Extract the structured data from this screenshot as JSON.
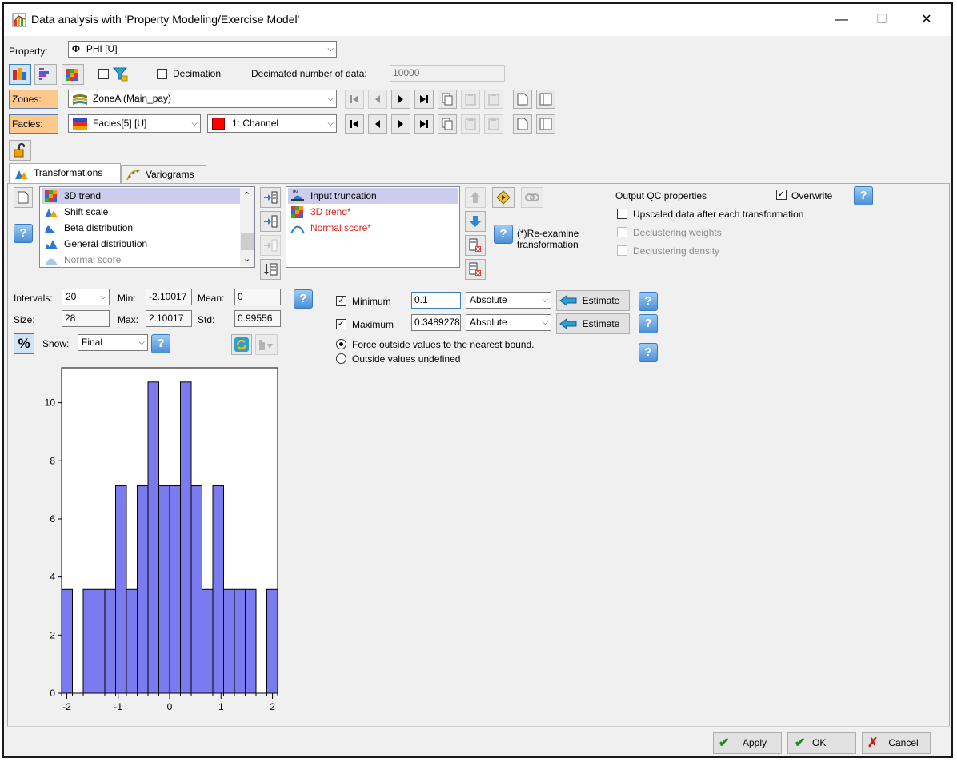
{
  "window": {
    "title": "Data analysis with 'Property Modeling/Exercise Model'",
    "minimize": "—",
    "maximize": "☐",
    "close": "✕"
  },
  "property": {
    "label": "Property:",
    "selected": "PHI [U]",
    "symbol": "Φ"
  },
  "toolbar": {
    "decimation_label": "Decimation",
    "decimated_number_label": "Decimated number of data:",
    "decimated_number_value": "10000"
  },
  "zones": {
    "label": "Zones:",
    "selected": "ZoneA (Main_pay)"
  },
  "facies": {
    "label": "Facies:",
    "selected": "Facies[5] [U]",
    "class_selected": "1: Channel",
    "class_color": "#ff0000"
  },
  "tabs": [
    {
      "label": "Transformations"
    },
    {
      "label": "Variograms"
    }
  ],
  "available_transforms": [
    {
      "label": "3D trend",
      "selected": true
    },
    {
      "label": "Shift scale"
    },
    {
      "label": "Beta distribution"
    },
    {
      "label": "General distribution"
    },
    {
      "label": "Normal score",
      "disabled": true
    }
  ],
  "applied_transforms": [
    {
      "label": "Input truncation",
      "selected": true
    },
    {
      "label": "3D trend*"
    },
    {
      "label": "Normal score*"
    }
  ],
  "reexamine_label": "(*)Re-examine transformation",
  "output_qc": {
    "title": "Output QC properties",
    "overwrite_label": "Overwrite",
    "overwrite_checked": true,
    "upscaled_label": "Upscaled data after each transformation",
    "declustering_weights_label": "Declustering weights",
    "declustering_density_label": "Declustering density"
  },
  "stats": {
    "intervals_label": "Intervals:",
    "intervals_value": "20",
    "min_label": "Min:",
    "min_value": "-2.10017",
    "mean_label": "Mean:",
    "mean_value": "0",
    "size_label": "Size:",
    "size_value": "28",
    "max_label": "Max:",
    "max_value": "2.10017",
    "std_label": "Std:",
    "std_value": "0.99556",
    "percent_label": "%",
    "show_label": "Show:",
    "show_value": "Final"
  },
  "truncation": {
    "minimum_label": "Minimum",
    "minimum_checked": true,
    "minimum_value": "0.1",
    "minimum_mode": "Absolute",
    "maximum_label": "Maximum",
    "maximum_checked": true,
    "maximum_value": "0.3489278",
    "maximum_mode": "Absolute",
    "estimate_label": "Estimate",
    "force_label": "Force outside values to the nearest bound.",
    "undefined_label": "Outside values undefined",
    "force_selected": true
  },
  "footer": {
    "apply_label": "Apply",
    "ok_label": "OK",
    "cancel_label": "Cancel"
  },
  "chart_data": {
    "type": "bar",
    "bar_color": "#7b7bf0",
    "bin_edges": [
      -2.1,
      -1.89,
      -1.68,
      -1.47,
      -1.26,
      -1.05,
      -0.84,
      -0.63,
      -0.42,
      -0.21,
      0.0,
      0.21,
      0.42,
      0.63,
      0.84,
      1.05,
      1.26,
      1.47,
      1.68,
      1.89,
      2.1
    ],
    "values": [
      3.57,
      0,
      3.57,
      3.57,
      3.57,
      7.14,
      3.57,
      7.14,
      10.71,
      7.14,
      7.14,
      10.71,
      7.14,
      3.57,
      7.14,
      3.57,
      3.57,
      3.57,
      0,
      3.57
    ],
    "xlim": [
      -2.1,
      2.1
    ],
    "ylim": [
      0,
      11.2
    ],
    "x_ticks": [
      -2,
      -1,
      0,
      1,
      2
    ],
    "y_ticks": [
      0,
      2,
      4,
      6,
      8,
      10
    ],
    "x_tick_labels": [
      "-2",
      "-1",
      "0",
      "1",
      "2"
    ],
    "y_tick_labels": [
      "0",
      "2",
      "4",
      "6",
      "8",
      "10"
    ]
  }
}
